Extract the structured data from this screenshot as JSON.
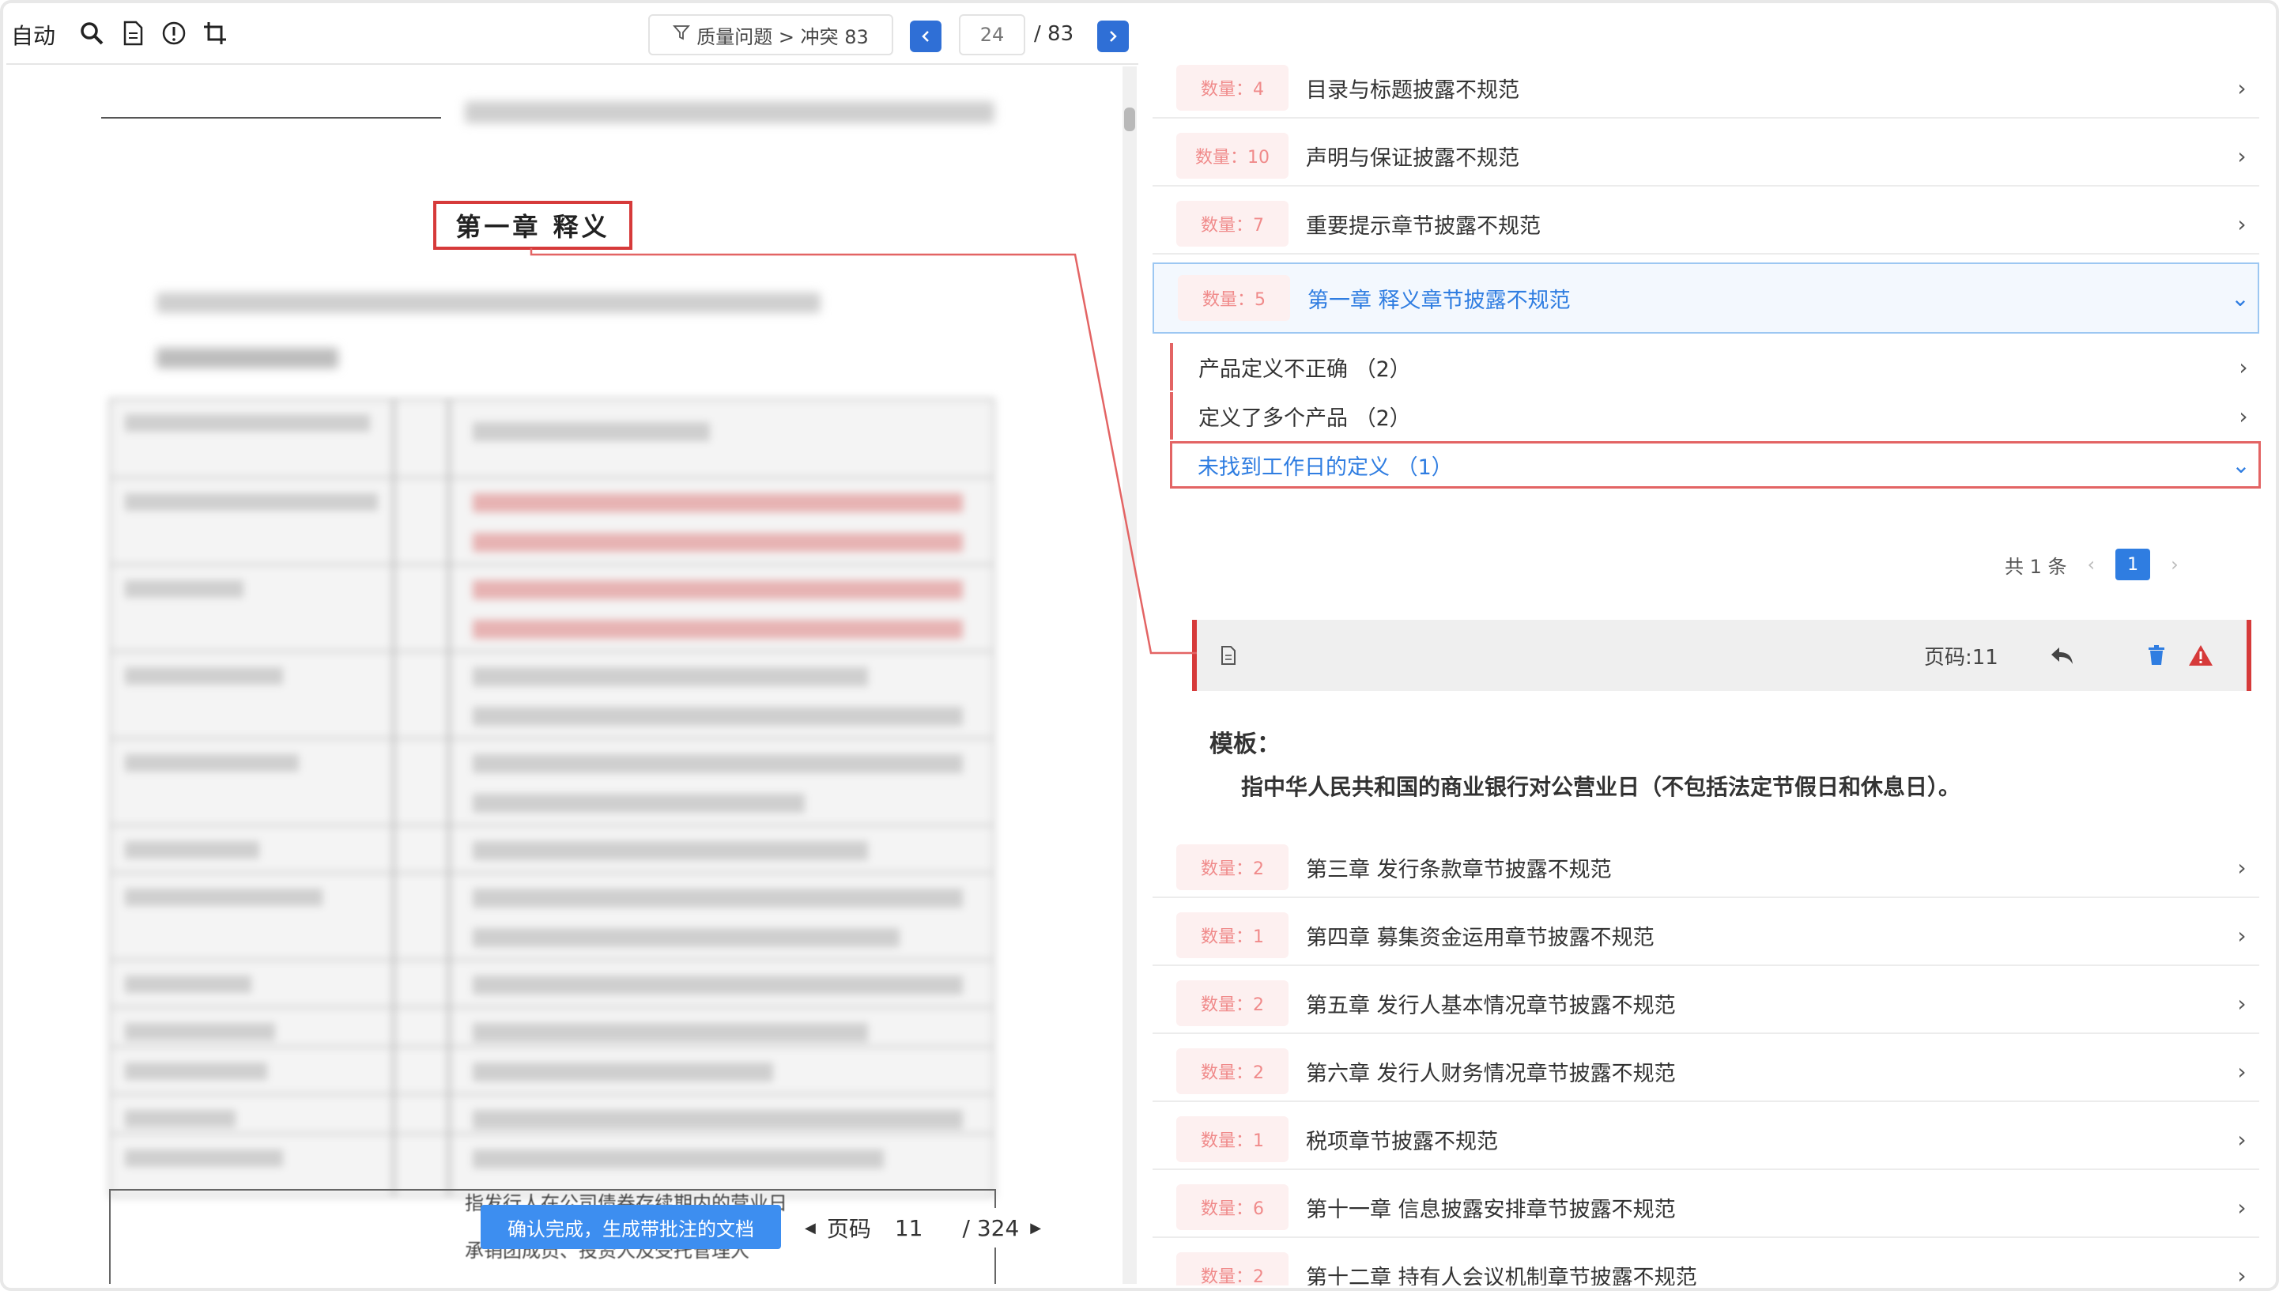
{
  "toolbar": {
    "auto_label": "自动",
    "filter_text": "质量问题 > 冲突 83",
    "current_page": "24",
    "total_pages": "/ 83"
  },
  "document": {
    "chapter_heading": "第一章  释义",
    "bottom_line1": "指发行人在公司债券存续期内的营业日",
    "bottom_line2": "承销团成员、投资人及受托管理人",
    "confirm_button": "确认完成，生成带批注的文档",
    "pager_label": "页码",
    "pager_current": "11",
    "pager_total": "/ 324"
  },
  "issues": [
    {
      "count": "数量：4",
      "title": "目录与标题披露不规范",
      "active": false
    },
    {
      "count": "数量：10",
      "title": "声明与保证披露不规范",
      "active": false
    },
    {
      "count": "数量：7",
      "title": "重要提示章节披露不规范",
      "active": false
    },
    {
      "count": "数量：5",
      "title": "第一章 释义章节披露不规范",
      "active": true
    },
    {
      "count": "数量：2",
      "title": "第三章 发行条款章节披露不规范",
      "active": false
    },
    {
      "count": "数量：1",
      "title": "第四章 募集资金运用章节披露不规范",
      "active": false
    },
    {
      "count": "数量：2",
      "title": "第五章 发行人基本情况章节披露不规范",
      "active": false
    },
    {
      "count": "数量：2",
      "title": "第六章 发行人财务情况章节披露不规范",
      "active": false
    },
    {
      "count": "数量：1",
      "title": "税项章节披露不规范",
      "active": false
    },
    {
      "count": "数量：6",
      "title": "第十一章 信息披露安排章节披露不规范",
      "active": false
    },
    {
      "count": "数量：2",
      "title": "第十二章 持有人会议机制章节披露不规范",
      "active": false
    }
  ],
  "sub_issues": [
    {
      "label": "产品定义不正确 （2）",
      "active": false
    },
    {
      "label": "定义了多个产品 （2）",
      "active": false
    },
    {
      "label": "未找到工作日的定义 （1）",
      "active": true
    }
  ],
  "pagination": {
    "total_text": "共 1 条",
    "page": "1"
  },
  "annotation": {
    "page_ref": "页码:11",
    "template_label": "模板：",
    "template_text": "指中华人民共和国的商业银行对公营业日（不包括法定节假日和休息日）。"
  },
  "colors": {
    "accent_blue": "#2f7de1",
    "accent_red": "#d63a3a",
    "badge_bg": "#fdf0f0"
  }
}
